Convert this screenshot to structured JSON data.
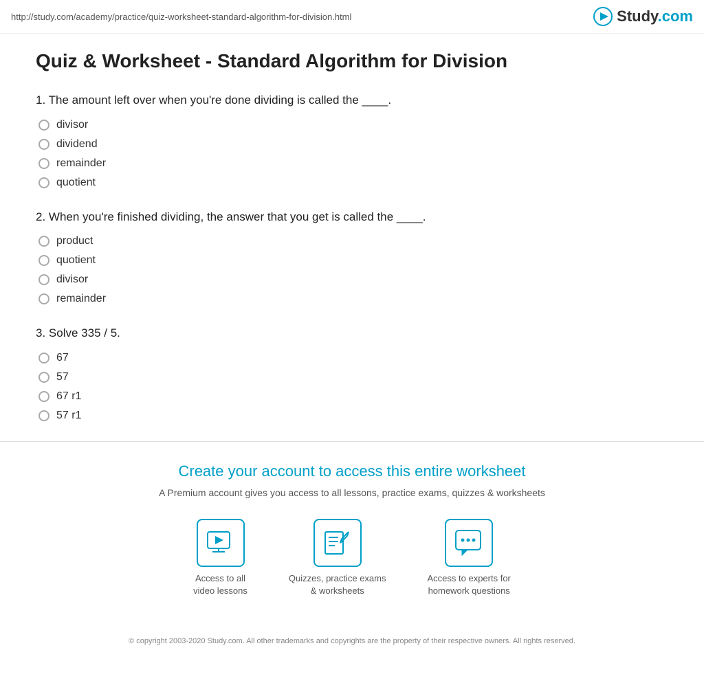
{
  "topbar": {
    "url": "http://study.com/academy/practice/quiz-worksheet-standard-algorithm-for-division.html",
    "logo_text_black": "Study",
    "logo_text_colored": ".com"
  },
  "page": {
    "title": "Quiz & Worksheet - Standard Algorithm for Division"
  },
  "questions": [
    {
      "number": "1.",
      "text": "The amount left over when you're done dividing is called the ____.",
      "options": [
        "divisor",
        "dividend",
        "remainder",
        "quotient"
      ]
    },
    {
      "number": "2.",
      "text": "When you're finished dividing, the answer that you get is called the ____.",
      "options": [
        "product",
        "quotient",
        "divisor",
        "remainder"
      ]
    },
    {
      "number": "3.",
      "text": "Solve 335 / 5.",
      "options": [
        "67",
        "57",
        "67 r1",
        "57 r1"
      ]
    }
  ],
  "promo": {
    "title": "Create your account to access this entire worksheet",
    "subtitle": "A Premium account gives you access to all lessons, practice exams, quizzes & worksheets",
    "features": [
      {
        "label": "Access to all\nvideo lessons",
        "icon": "video"
      },
      {
        "label": "Quizzes, practice exams\n& worksheets",
        "icon": "quiz"
      },
      {
        "label": "Access to experts for\nhomework questions",
        "icon": "chat"
      }
    ]
  },
  "footer": {
    "text": "© copyright 2003-2020 Study.com. All other trademarks and copyrights are the property of their respective owners. All rights reserved."
  }
}
